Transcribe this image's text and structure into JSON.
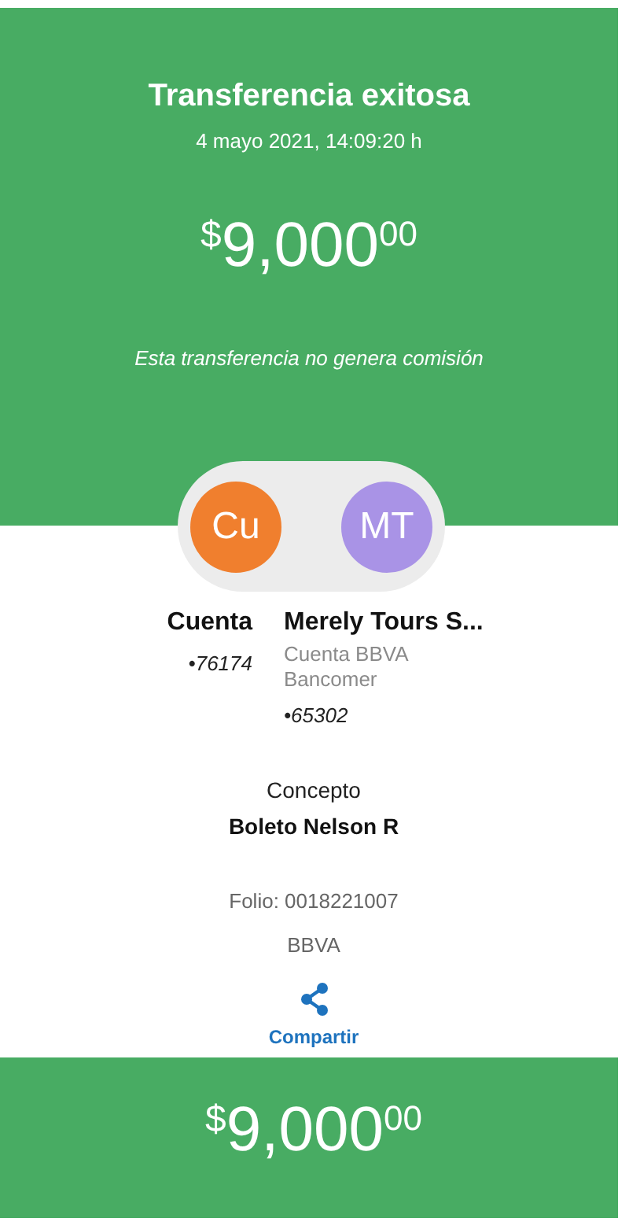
{
  "header": {
    "title": "Transferencia exitosa",
    "datetime": "4 mayo 2021, 14:09:20 h",
    "amount": {
      "currency": "$",
      "whole": "9,000",
      "cents": "00"
    },
    "note": "Esta transferencia no genera comisión"
  },
  "parties": [
    {
      "initials": "Cu",
      "color": "#f07f2e",
      "name": "Cuenta",
      "account": "•76174"
    },
    {
      "initials": "MT",
      "color": "#a993e6",
      "name": "Merely Tours S...",
      "details": [
        "Cuenta BBVA",
        "Bancomer"
      ],
      "account": "•65302"
    }
  ],
  "concept": {
    "label": "Concepto",
    "value": "Boleto Nelson R"
  },
  "folio": "Folio: 0018221007",
  "bank": "BBVA",
  "share": {
    "label": "Compartir"
  },
  "footer": {
    "amount": {
      "currency": "$",
      "whole": "9,000",
      "cents": "00"
    }
  }
}
